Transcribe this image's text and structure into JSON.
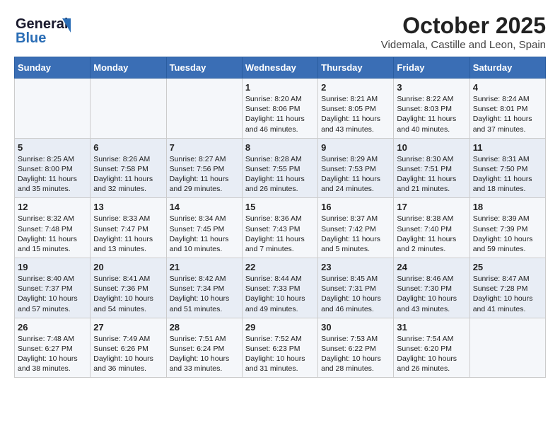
{
  "logo": {
    "line1": "General",
    "line2": "Blue"
  },
  "title": "October 2025",
  "location": "Videmala, Castille and Leon, Spain",
  "days_of_week": [
    "Sunday",
    "Monday",
    "Tuesday",
    "Wednesday",
    "Thursday",
    "Friday",
    "Saturday"
  ],
  "weeks": [
    [
      {
        "day": "",
        "sunrise": "",
        "sunset": "",
        "daylight": ""
      },
      {
        "day": "",
        "sunrise": "",
        "sunset": "",
        "daylight": ""
      },
      {
        "day": "",
        "sunrise": "",
        "sunset": "",
        "daylight": ""
      },
      {
        "day": "1",
        "sunrise": "Sunrise: 8:20 AM",
        "sunset": "Sunset: 8:06 PM",
        "daylight": "Daylight: 11 hours and 46 minutes."
      },
      {
        "day": "2",
        "sunrise": "Sunrise: 8:21 AM",
        "sunset": "Sunset: 8:05 PM",
        "daylight": "Daylight: 11 hours and 43 minutes."
      },
      {
        "day": "3",
        "sunrise": "Sunrise: 8:22 AM",
        "sunset": "Sunset: 8:03 PM",
        "daylight": "Daylight: 11 hours and 40 minutes."
      },
      {
        "day": "4",
        "sunrise": "Sunrise: 8:24 AM",
        "sunset": "Sunset: 8:01 PM",
        "daylight": "Daylight: 11 hours and 37 minutes."
      }
    ],
    [
      {
        "day": "5",
        "sunrise": "Sunrise: 8:25 AM",
        "sunset": "Sunset: 8:00 PM",
        "daylight": "Daylight: 11 hours and 35 minutes."
      },
      {
        "day": "6",
        "sunrise": "Sunrise: 8:26 AM",
        "sunset": "Sunset: 7:58 PM",
        "daylight": "Daylight: 11 hours and 32 minutes."
      },
      {
        "day": "7",
        "sunrise": "Sunrise: 8:27 AM",
        "sunset": "Sunset: 7:56 PM",
        "daylight": "Daylight: 11 hours and 29 minutes."
      },
      {
        "day": "8",
        "sunrise": "Sunrise: 8:28 AM",
        "sunset": "Sunset: 7:55 PM",
        "daylight": "Daylight: 11 hours and 26 minutes."
      },
      {
        "day": "9",
        "sunrise": "Sunrise: 8:29 AM",
        "sunset": "Sunset: 7:53 PM",
        "daylight": "Daylight: 11 hours and 24 minutes."
      },
      {
        "day": "10",
        "sunrise": "Sunrise: 8:30 AM",
        "sunset": "Sunset: 7:51 PM",
        "daylight": "Daylight: 11 hours and 21 minutes."
      },
      {
        "day": "11",
        "sunrise": "Sunrise: 8:31 AM",
        "sunset": "Sunset: 7:50 PM",
        "daylight": "Daylight: 11 hours and 18 minutes."
      }
    ],
    [
      {
        "day": "12",
        "sunrise": "Sunrise: 8:32 AM",
        "sunset": "Sunset: 7:48 PM",
        "daylight": "Daylight: 11 hours and 15 minutes."
      },
      {
        "day": "13",
        "sunrise": "Sunrise: 8:33 AM",
        "sunset": "Sunset: 7:47 PM",
        "daylight": "Daylight: 11 hours and 13 minutes."
      },
      {
        "day": "14",
        "sunrise": "Sunrise: 8:34 AM",
        "sunset": "Sunset: 7:45 PM",
        "daylight": "Daylight: 11 hours and 10 minutes."
      },
      {
        "day": "15",
        "sunrise": "Sunrise: 8:36 AM",
        "sunset": "Sunset: 7:43 PM",
        "daylight": "Daylight: 11 hours and 7 minutes."
      },
      {
        "day": "16",
        "sunrise": "Sunrise: 8:37 AM",
        "sunset": "Sunset: 7:42 PM",
        "daylight": "Daylight: 11 hours and 5 minutes."
      },
      {
        "day": "17",
        "sunrise": "Sunrise: 8:38 AM",
        "sunset": "Sunset: 7:40 PM",
        "daylight": "Daylight: 11 hours and 2 minutes."
      },
      {
        "day": "18",
        "sunrise": "Sunrise: 8:39 AM",
        "sunset": "Sunset: 7:39 PM",
        "daylight": "Daylight: 10 hours and 59 minutes."
      }
    ],
    [
      {
        "day": "19",
        "sunrise": "Sunrise: 8:40 AM",
        "sunset": "Sunset: 7:37 PM",
        "daylight": "Daylight: 10 hours and 57 minutes."
      },
      {
        "day": "20",
        "sunrise": "Sunrise: 8:41 AM",
        "sunset": "Sunset: 7:36 PM",
        "daylight": "Daylight: 10 hours and 54 minutes."
      },
      {
        "day": "21",
        "sunrise": "Sunrise: 8:42 AM",
        "sunset": "Sunset: 7:34 PM",
        "daylight": "Daylight: 10 hours and 51 minutes."
      },
      {
        "day": "22",
        "sunrise": "Sunrise: 8:44 AM",
        "sunset": "Sunset: 7:33 PM",
        "daylight": "Daylight: 10 hours and 49 minutes."
      },
      {
        "day": "23",
        "sunrise": "Sunrise: 8:45 AM",
        "sunset": "Sunset: 7:31 PM",
        "daylight": "Daylight: 10 hours and 46 minutes."
      },
      {
        "day": "24",
        "sunrise": "Sunrise: 8:46 AM",
        "sunset": "Sunset: 7:30 PM",
        "daylight": "Daylight: 10 hours and 43 minutes."
      },
      {
        "day": "25",
        "sunrise": "Sunrise: 8:47 AM",
        "sunset": "Sunset: 7:28 PM",
        "daylight": "Daylight: 10 hours and 41 minutes."
      }
    ],
    [
      {
        "day": "26",
        "sunrise": "Sunrise: 7:48 AM",
        "sunset": "Sunset: 6:27 PM",
        "daylight": "Daylight: 10 hours and 38 minutes."
      },
      {
        "day": "27",
        "sunrise": "Sunrise: 7:49 AM",
        "sunset": "Sunset: 6:26 PM",
        "daylight": "Daylight: 10 hours and 36 minutes."
      },
      {
        "day": "28",
        "sunrise": "Sunrise: 7:51 AM",
        "sunset": "Sunset: 6:24 PM",
        "daylight": "Daylight: 10 hours and 33 minutes."
      },
      {
        "day": "29",
        "sunrise": "Sunrise: 7:52 AM",
        "sunset": "Sunset: 6:23 PM",
        "daylight": "Daylight: 10 hours and 31 minutes."
      },
      {
        "day": "30",
        "sunrise": "Sunrise: 7:53 AM",
        "sunset": "Sunset: 6:22 PM",
        "daylight": "Daylight: 10 hours and 28 minutes."
      },
      {
        "day": "31",
        "sunrise": "Sunrise: 7:54 AM",
        "sunset": "Sunset: 6:20 PM",
        "daylight": "Daylight: 10 hours and 26 minutes."
      },
      {
        "day": "",
        "sunrise": "",
        "sunset": "",
        "daylight": ""
      }
    ]
  ]
}
